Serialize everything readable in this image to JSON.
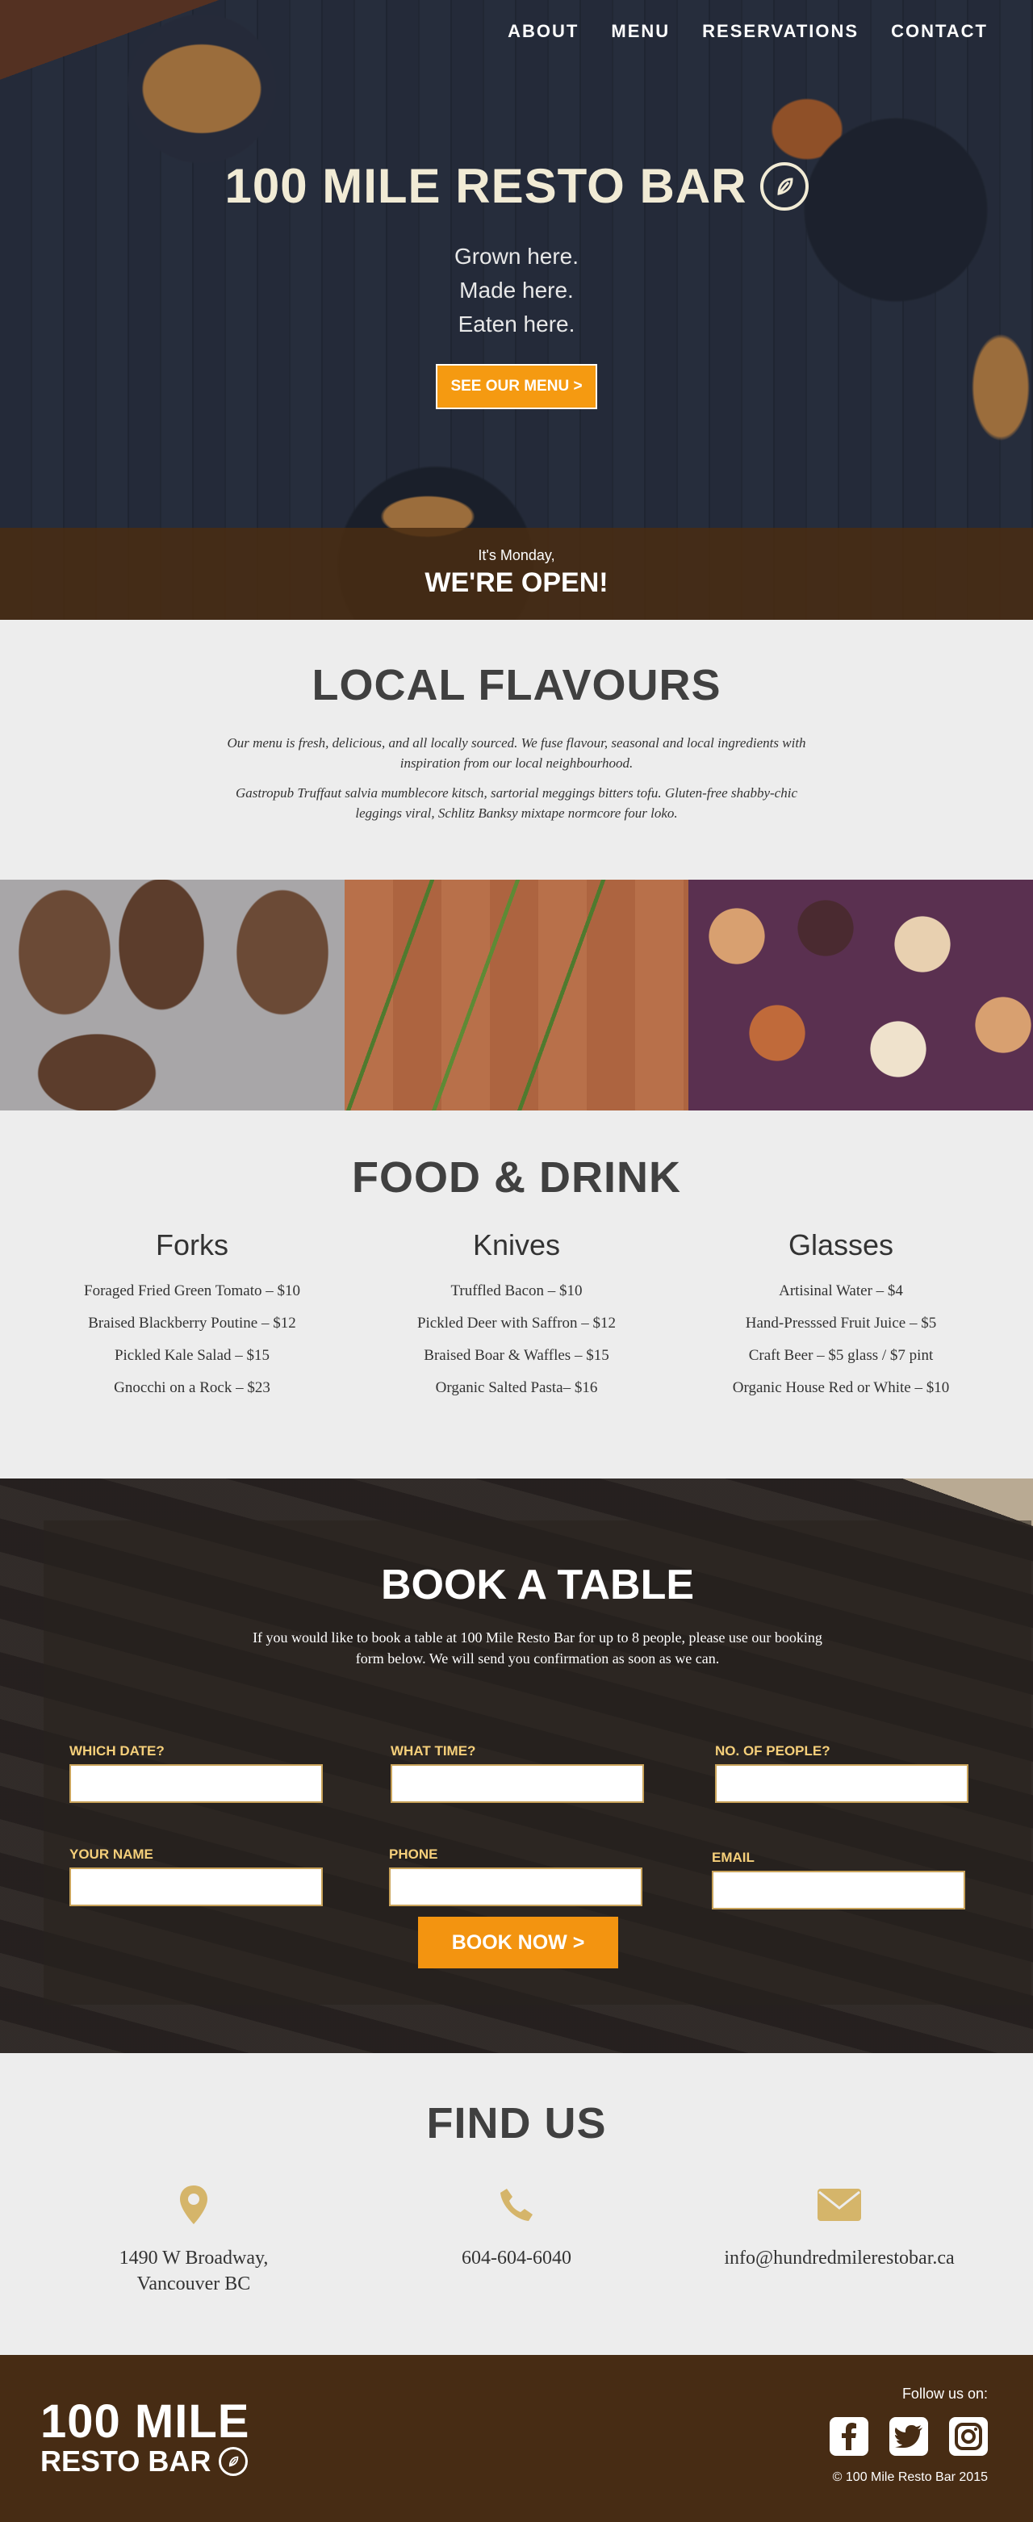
{
  "nav": {
    "items": [
      {
        "label": "ABOUT"
      },
      {
        "label": "MENU"
      },
      {
        "label": "RESERVATIONS"
      },
      {
        "label": "CONTACT"
      }
    ]
  },
  "hero": {
    "title": "100 MILE RESTO BAR",
    "tagline": [
      "Grown here.",
      "Made here.",
      "Eaten here."
    ],
    "cta_label": "SEE OUR MENU >",
    "open_sub": "It's Monday,",
    "open_main": "WE'RE OPEN!"
  },
  "flavours": {
    "title": "LOCAL FLAVOURS",
    "para1": "Our menu is fresh, delicious, and all locally sourced. We fuse flavour, seasonal and local ingredients with inspiration from our local neighbourhood.",
    "para2": "Gastropub Truffaut salvia mumblecore kitsch, sartorial meggings bitters tofu. Gluten-free shabby-chic leggings viral, Schlitz Banksy mixtape normcore four loko."
  },
  "food": {
    "title": "FOOD & DRINK",
    "columns": [
      {
        "heading": "Forks",
        "items": [
          "Foraged Fried Green Tomato – $10",
          "Braised Blackberry Poutine – $12",
          "Pickled Kale Salad – $15",
          "Gnocchi on a Rock – $23"
        ]
      },
      {
        "heading": "Knives",
        "items": [
          "Truffled Bacon – $10",
          "Pickled Deer with Saffron – $12",
          "Braised Boar & Waffles – $15",
          "Organic Salted Pasta– $16"
        ]
      },
      {
        "heading": "Glasses",
        "items": [
          "Artisinal Water – $4",
          "Hand-Presssed Fruit Juice – $5",
          "Craft Beer – $5 glass / $7 pint",
          "Organic House Red or White – $10"
        ]
      }
    ]
  },
  "booking": {
    "title": "BOOK A TABLE",
    "text": "If you would like to book a table at 100 Mile Resto Bar for up to 8 people, please use our booking form below. We will send you confirmation as soon as we can.",
    "fields": {
      "date": "WHICH DATE?",
      "time": "WHAT TIME?",
      "people": "NO. OF PEOPLE?",
      "name": "YOUR NAME",
      "phone": "PHONE",
      "email": "EMAIL"
    },
    "button": "BOOK NOW >"
  },
  "find": {
    "title": "FIND US",
    "address_line1": "1490 W Broadway,",
    "address_line2": "Vancouver BC",
    "phone": "604-604-6040",
    "email": "info@hundredmilerestobar.ca"
  },
  "footer": {
    "logo_line1": "100 MILE",
    "logo_line2": "RESTO BAR",
    "follow": "Follow us on:",
    "copyright": "© 100 Mile Resto Bar 2015"
  },
  "colors": {
    "accent": "#f59a11",
    "footer_bg": "#472c14",
    "icon_gold": "#d5b56a"
  }
}
